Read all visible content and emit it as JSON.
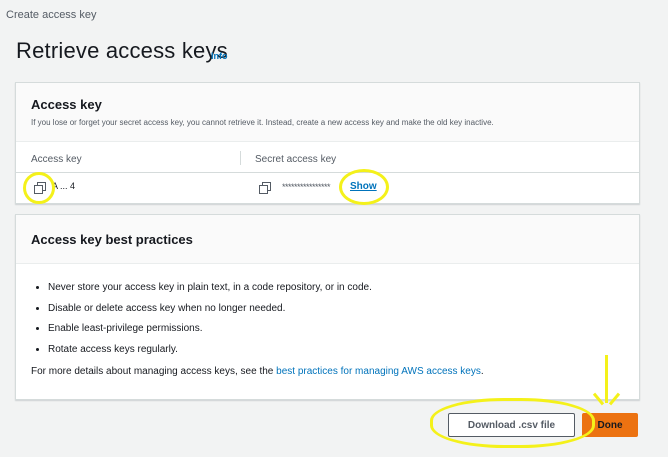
{
  "breadcrumb": "Create access key",
  "title": "Retrieve access keys",
  "info_link": "Info",
  "access_key_panel": {
    "title": "Access key",
    "description": "If you lose or forget your secret access key, you cannot retrieve it. Instead, create a new access key and make the old key inactive.",
    "columns": [
      "Access key",
      "Secret access key"
    ],
    "access_key_value": "A          ...                 4",
    "secret_masked": "****************",
    "show_label": "Show"
  },
  "best_practices_panel": {
    "title": "Access key best practices",
    "items": [
      "Never store your access key in plain text, in a code repository, or in code.",
      "Disable or delete access key when no longer needed.",
      "Enable least-privilege permissions.",
      "Rotate access keys regularly."
    ],
    "more_prefix": "For more details about managing access keys, see the ",
    "more_link": "best practices for managing AWS access keys",
    "more_suffix": "."
  },
  "buttons": {
    "download_csv": "Download .csv file",
    "done": "Done"
  },
  "colors": {
    "link": "#0073bb",
    "primary_button": "#ec7211",
    "highlight": "#f4f11a"
  }
}
